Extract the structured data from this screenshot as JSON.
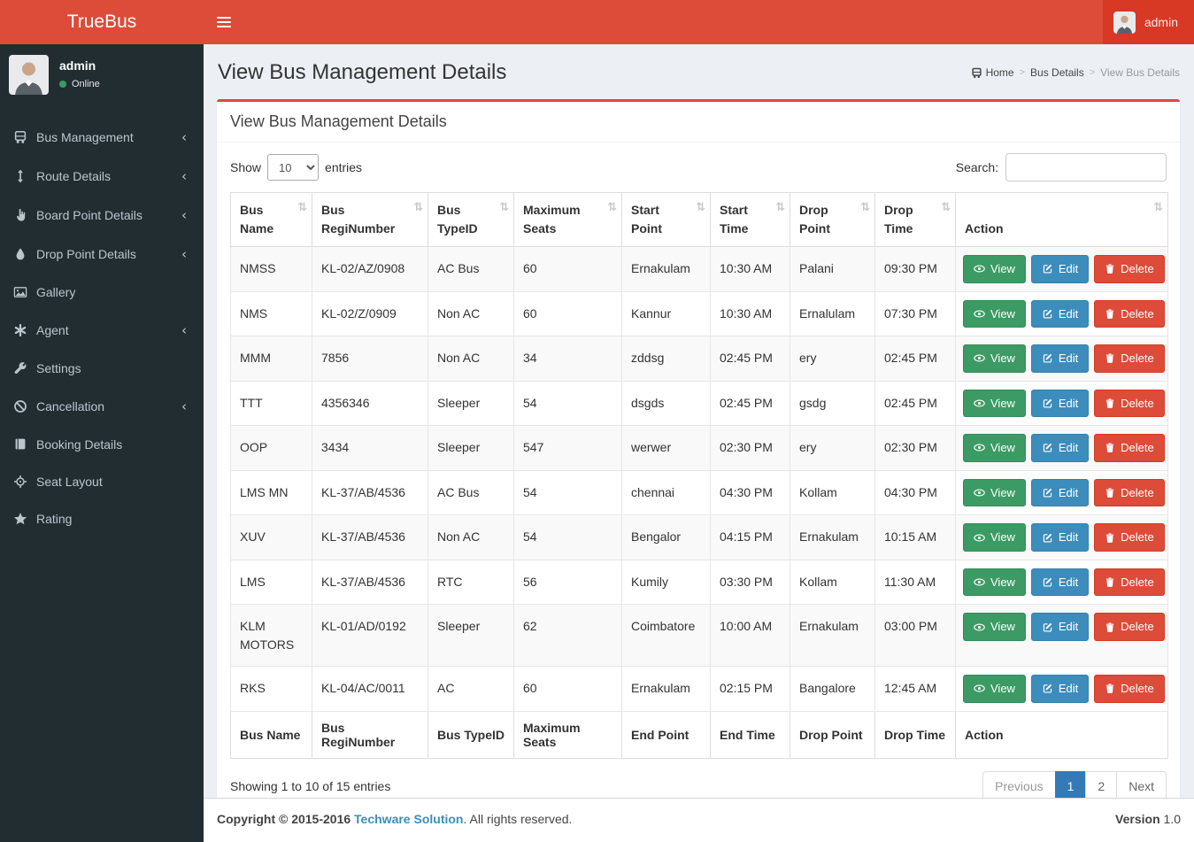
{
  "app": {
    "brand": "TrueBus"
  },
  "header": {
    "user_name": "admin"
  },
  "sidebar": {
    "chevron_glyph": "‹",
    "user": {
      "name": "admin",
      "status": "Online"
    },
    "items": [
      {
        "label": "Bus Management",
        "icon": "bus-icon",
        "chevron": true
      },
      {
        "label": "Route Details",
        "icon": "arrows-vertical-icon",
        "chevron": true
      },
      {
        "label": "Board Point Details",
        "icon": "hand-pointer-icon",
        "chevron": true
      },
      {
        "label": "Drop Point Details",
        "icon": "droplet-icon",
        "chevron": true
      },
      {
        "label": "Gallery",
        "icon": "image-icon",
        "chevron": false
      },
      {
        "label": "Agent",
        "icon": "asterisk-icon",
        "chevron": true
      },
      {
        "label": "Settings",
        "icon": "wrench-icon",
        "chevron": false
      },
      {
        "label": "Cancellation",
        "icon": "ban-icon",
        "chevron": true
      },
      {
        "label": "Booking Details",
        "icon": "book-icon",
        "chevron": false
      },
      {
        "label": "Seat Layout",
        "icon": "crosshair-icon",
        "chevron": false
      },
      {
        "label": "Rating",
        "icon": "star-icon",
        "chevron": false
      }
    ]
  },
  "page": {
    "title": "View Bus Management Details",
    "breadcrumb": {
      "separator": ">",
      "home": "Home",
      "level1": "Bus Details",
      "active": "View Bus Details"
    }
  },
  "panel": {
    "title": "View Bus Management Details",
    "show_label": "Show",
    "entries_value": "10",
    "entries_label": "entries",
    "search_label": "Search:",
    "search_value": ""
  },
  "table": {
    "sort_glyph": "⇅",
    "headers": [
      "Bus Name",
      "Bus RegiNumber",
      "Bus TypeID",
      "Maximum Seats",
      "Start Point",
      "Start Time",
      "Drop Point",
      "Drop Time",
      "Action"
    ],
    "footers": [
      "Bus Name",
      "Bus RegiNumber",
      "Bus TypeID",
      "Maximum Seats",
      "End Point",
      "End Time",
      "Drop Point",
      "Drop Time",
      "Action"
    ],
    "actions": {
      "view": "View",
      "edit": "Edit",
      "delete": "Delete"
    },
    "rows": [
      [
        "NMSS",
        "KL-02/AZ/0908",
        "AC Bus",
        "60",
        "Ernakulam",
        "10:30 AM",
        "Palani",
        "09:30 PM"
      ],
      [
        "NMS",
        "KL-02/Z/0909",
        "Non AC",
        "60",
        "Kannur",
        "10:30 AM",
        "Ernalulam",
        "07:30 PM"
      ],
      [
        "MMM",
        "7856",
        "Non AC",
        "34",
        "zddsg",
        "02:45 PM",
        "ery",
        "02:45 PM"
      ],
      [
        "TTT",
        "4356346",
        "Sleeper",
        "54",
        "dsgds",
        "02:45 PM",
        "gsdg",
        "02:45 PM"
      ],
      [
        "OOP",
        "3434",
        "Sleeper",
        "547",
        "werwer",
        "02:30 PM",
        "ery",
        "02:30 PM"
      ],
      [
        "LMS MN",
        "KL-37/AB/4536",
        "AC Bus",
        "54",
        "chennai",
        "04:30 PM",
        "Kollam",
        "04:30 PM"
      ],
      [
        "XUV",
        "KL-37/AB/4536",
        "Non AC",
        "54",
        "Bengalor",
        "04:15 PM",
        "Ernakulam",
        "10:15 AM"
      ],
      [
        "LMS",
        "KL-37/AB/4536",
        "RTC",
        "56",
        "Kumily",
        "03:30 PM",
        "Kollam",
        "11:30 AM"
      ],
      [
        "KLM MOTORS",
        "KL-01/AD/0192",
        "Sleeper",
        "62",
        "Coimbatore",
        "10:00 AM",
        "Ernakulam",
        "03:00 PM"
      ],
      [
        "RKS",
        "KL-04/AC/0011",
        "AC",
        "60",
        "Ernakulam",
        "02:15 PM",
        "Bangalore",
        "12:45 AM"
      ]
    ]
  },
  "pagination": {
    "info": "Showing 1 to 10 of 15 entries",
    "previous": "Previous",
    "page1": "1",
    "page2": "2",
    "next": "Next"
  },
  "footer": {
    "copyright": "Copyright © 2015-2016",
    "company": "Techware Solution",
    "rights": ". All rights reserved.",
    "version_label": "Version",
    "version_value": "1.0"
  },
  "colors": {
    "header_red": "#dd4b39",
    "sidebar_dark": "#222d32",
    "view_green": "#3c9b64",
    "edit_blue": "#3c8dbc",
    "delete_red": "#dd4b39",
    "pagination_active": "#337ab7"
  }
}
